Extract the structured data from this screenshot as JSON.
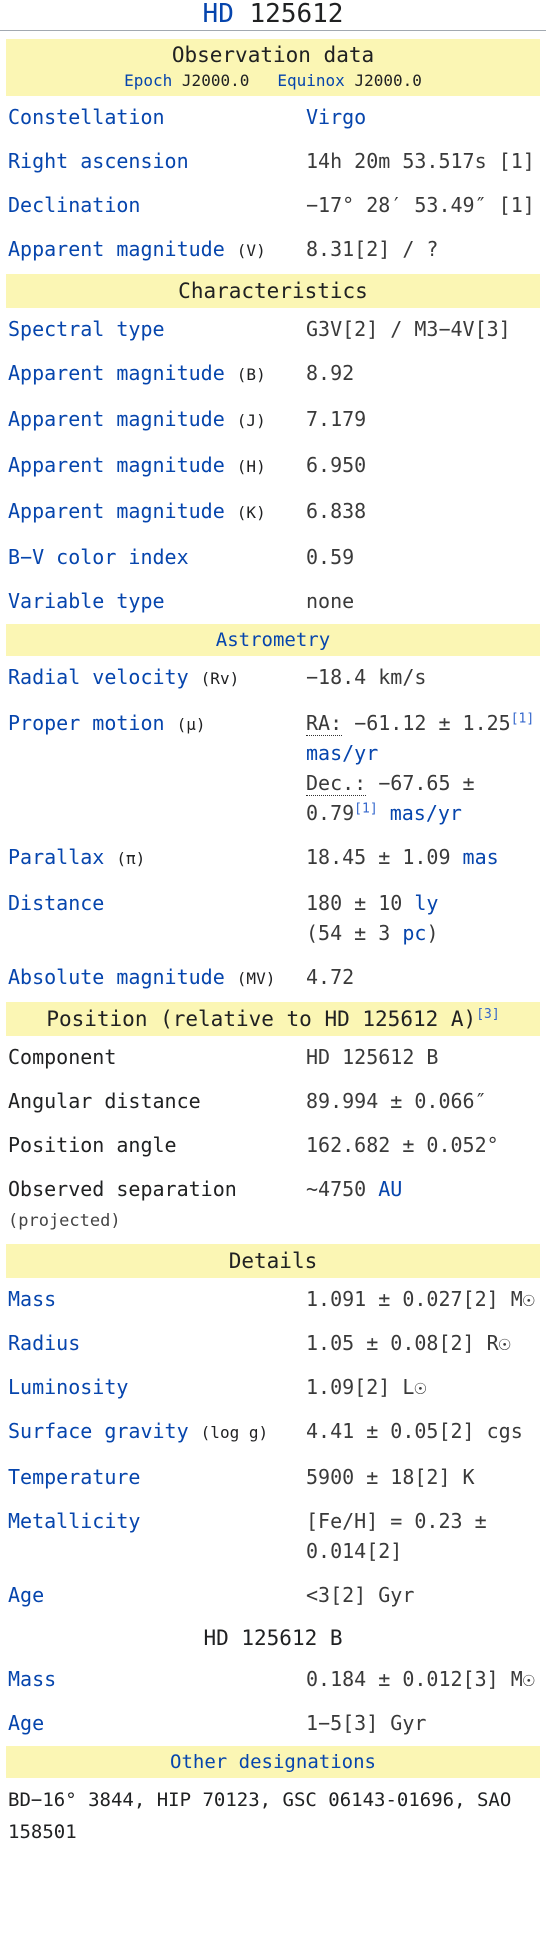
{
  "title": {
    "link": "HD",
    "rest": "125612"
  },
  "obs": {
    "heading": "Observation data",
    "epoch_k": "Epoch",
    "epoch_v": "J2000.0",
    "equinox_k": "Equinox",
    "equinox_v": "J2000.0"
  },
  "rows1": [
    {
      "label": "Constellation",
      "value": "Virgo"
    },
    {
      "label": "Right ascension",
      "value": "14h 20m 53.517s [1]"
    },
    {
      "label": "Declination",
      "value": "−17° 28′ 53.49″ [1]"
    },
    {
      "label": "Apparent magnitude",
      "paren": "(V)",
      "value": "8.31[2] / ?"
    }
  ],
  "char": {
    "heading": "Characteristics",
    "rows": [
      {
        "label": "Spectral type",
        "value": "G3V[2] / M3−4V[3]"
      },
      {
        "label": "Apparent magnitude",
        "paren": "(B)",
        "value": "8.92"
      },
      {
        "label": "Apparent magnitude",
        "paren": "(J)",
        "value": "7.179"
      },
      {
        "label": "Apparent magnitude",
        "paren": "(H)",
        "value": "6.950"
      },
      {
        "label": "Apparent magnitude",
        "paren": "(K)",
        "value": "6.838"
      },
      {
        "label": "B−V color index",
        "value": "0.59"
      },
      {
        "label": "Variable type",
        "value": "none"
      }
    ]
  },
  "astro": {
    "heading": "Astrometry",
    "rows": [
      {
        "label": "Radial velocity",
        "paren": "(Rv)",
        "value": "−18.4 km/s"
      },
      {
        "label": "Proper motion",
        "paren": "(μ)",
        "ra_k": "RA:",
        "ra_v": "−61.12 ± 1.25",
        "ra_r": "[1]",
        "ra_u": "mas/yr",
        "dec_k": "Dec.:",
        "dec_v": "−67.65 ± 0.79",
        "dec_r": "[1]",
        "dec_u": "mas/yr"
      },
      {
        "label": "Parallax",
        "paren": "(π)",
        "value": "18.45 ± 1.09",
        "unit": "mas"
      },
      {
        "label": "Distance",
        "value": "180 ± 10",
        "unit": "ly",
        "value2": "(54 ± 3",
        "unit2": "pc",
        ")": ")"
      },
      {
        "label": "Absolute magnitude",
        "paren": "(MV)",
        "value": "4.72"
      }
    ]
  },
  "pos": {
    "heading": "Position (relative to HD 125612 A)",
    "ref": "[3]",
    "rows": [
      {
        "label": "Component",
        "value": "HD 125612 B"
      },
      {
        "label": "Angular distance",
        "value": "89.994 ± 0.066″"
      },
      {
        "label": "Position angle",
        "value": "162.682 ± 0.052°"
      },
      {
        "label": "Observed separation",
        "sub": "(projected)",
        "value": "~4750",
        "unit": "AU"
      }
    ]
  },
  "details": {
    "heading": "Details",
    "rows": [
      {
        "label": "Mass",
        "value": "1.091 ± 0.027[2] M☉"
      },
      {
        "label": "Radius",
        "value": "1.05 ± 0.08[2] R☉"
      },
      {
        "label": "Luminosity",
        "value": "1.09[2] L☉"
      },
      {
        "label": "Surface gravity",
        "paren": "(log g)",
        "value": "4.41 ± 0.05[2] cgs"
      },
      {
        "label": "Temperature",
        "value": "5900 ± 18[2] K"
      },
      {
        "label": "Metallicity",
        "value": "[Fe/H] = 0.23 ± 0.014[2]"
      },
      {
        "label": "Age",
        "value": "<3[2] Gyr"
      }
    ],
    "sub": "HD 125612 B",
    "rowsB": [
      {
        "label": "Mass",
        "value": "0.184 ± 0.012[3] M☉"
      },
      {
        "label": "Age",
        "value": "1−5[3] Gyr"
      }
    ]
  },
  "other": {
    "heading": "Other designations",
    "text": "BD−16° 3844, HIP 70123, GSC 06143-01696, SAO 158501"
  }
}
